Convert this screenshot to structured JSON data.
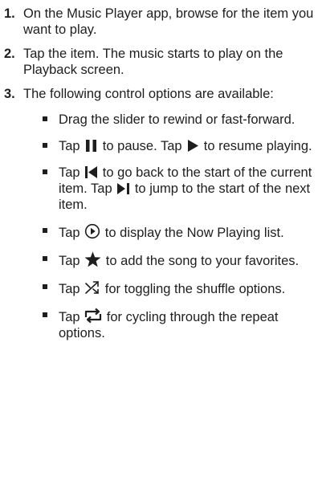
{
  "steps": [
    {
      "num": "1.",
      "text": "On the Music Player app, browse for the item you want to play."
    },
    {
      "num": "2.",
      "text": "Tap the item. The music starts to play on the Playback screen."
    },
    {
      "num": "3.",
      "text": "The following control options are available:"
    }
  ],
  "bullets": [
    {
      "text": "Drag the slider to rewind or fast-forward."
    },
    {
      "pre": "Tap",
      "icon": "pause-icon",
      "mid": "to pause. Tap",
      "icon2": "play-icon",
      "post": "to resume playing."
    },
    {
      "pre": "Tap",
      "icon": "previous-track-icon",
      "mid": "to go back to the start of the current item. Tap",
      "icon2": "next-track-icon",
      "post": "to jump to the start of the next item."
    },
    {
      "pre": "Tap",
      "icon": "now-playing-list-icon",
      "post": "to display the Now Playing list."
    },
    {
      "pre": "Tap",
      "icon": "star-icon",
      "post": "to add the song to your favorites."
    },
    {
      "pre": "Tap",
      "icon": "shuffle-icon",
      "post": "for toggling the shuffle options."
    },
    {
      "pre": "Tap",
      "icon": "repeat-icon",
      "post": "for cycling through the repeat options."
    }
  ],
  "colors": {
    "text": "#1e1e1e",
    "background": "#ffffff"
  }
}
